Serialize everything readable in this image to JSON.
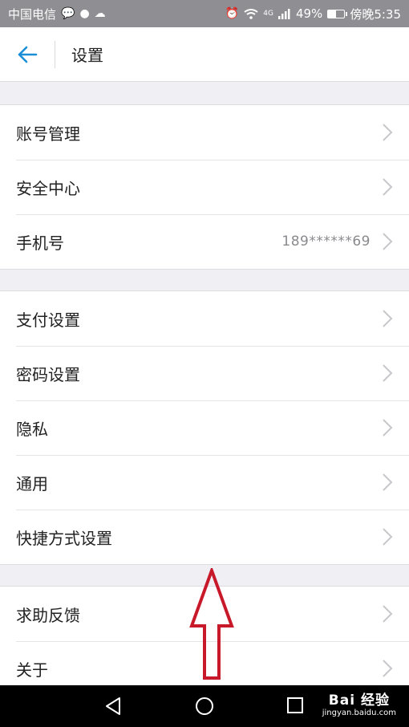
{
  "status_bar": {
    "carrier": "中国电信",
    "network": "4G",
    "battery": "49%",
    "battery_level": 0.49,
    "time": "傍晚5:35"
  },
  "header": {
    "title": "设置"
  },
  "sections": [
    {
      "items": [
        {
          "label": "账号管理",
          "value": ""
        },
        {
          "label": "安全中心",
          "value": ""
        },
        {
          "label": "手机号",
          "value": "189******69"
        }
      ]
    },
    {
      "items": [
        {
          "label": "支付设置",
          "value": ""
        },
        {
          "label": "密码设置",
          "value": ""
        },
        {
          "label": "隐私",
          "value": ""
        },
        {
          "label": "通用",
          "value": ""
        },
        {
          "label": "快捷方式设置",
          "value": ""
        }
      ]
    },
    {
      "items": [
        {
          "label": "求助反馈",
          "value": ""
        },
        {
          "label": "关于",
          "value": ""
        }
      ]
    }
  ],
  "watermark": {
    "logo": "Bai 经验",
    "url": "jingyan.baidu.com"
  },
  "colors": {
    "accent": "#1a8fd6",
    "annotation": "#c8192b",
    "chevron": "#c7c7cc"
  }
}
